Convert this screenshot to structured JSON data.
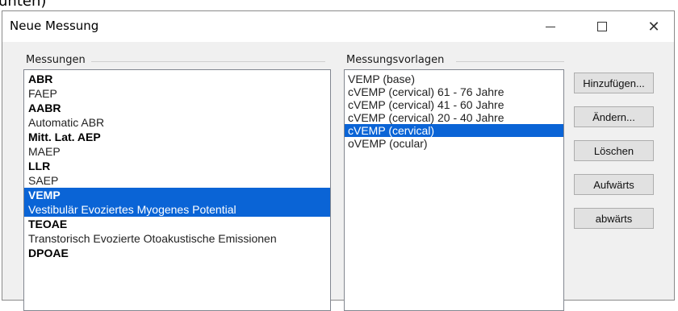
{
  "window": {
    "title": "Neue Messung",
    "top_fragment": "unten)"
  },
  "measurements": {
    "label": "Messungen",
    "items": [
      {
        "text": "ABR",
        "bold": true,
        "selected": false
      },
      {
        "text": "FAEP",
        "bold": false,
        "selected": false
      },
      {
        "text": "AABR",
        "bold": true,
        "selected": false
      },
      {
        "text": "Automatic ABR",
        "bold": false,
        "selected": false
      },
      {
        "text": "Mitt. Lat. AEP",
        "bold": true,
        "selected": false
      },
      {
        "text": "MAEP",
        "bold": false,
        "selected": false
      },
      {
        "text": "LLR",
        "bold": true,
        "selected": false
      },
      {
        "text": "SAEP",
        "bold": false,
        "selected": false
      },
      {
        "text": "VEMP",
        "bold": true,
        "selected": true
      },
      {
        "text": "Vestibulär Evoziertes Myogenes Potential",
        "bold": false,
        "selected": true
      },
      {
        "text": "TEOAE",
        "bold": true,
        "selected": false
      },
      {
        "text": "Transtorisch Evozierte Otoakustische Emissionen",
        "bold": false,
        "selected": false
      },
      {
        "text": "DPOAE",
        "bold": true,
        "selected": false
      }
    ]
  },
  "templates": {
    "label": "Messungsvorlagen",
    "items": [
      {
        "text": "VEMP (base)",
        "selected": false
      },
      {
        "text": "cVEMP (cervical) 61 - 76 Jahre",
        "selected": false
      },
      {
        "text": "cVEMP (cervical) 41 - 60 Jahre",
        "selected": false
      },
      {
        "text": "cVEMP (cervical) 20 - 40 Jahre",
        "selected": false
      },
      {
        "text": "cVEMP (cervical)",
        "selected": true
      },
      {
        "text": "oVEMP (ocular)",
        "selected": false
      }
    ]
  },
  "buttons": {
    "add": "Hinzufügen...",
    "edit": "Ändern...",
    "delete": "Löschen",
    "up": "Aufwärts",
    "down": "abwärts"
  },
  "titlebar_buttons": {
    "close_glyph": "✕"
  },
  "colors": {
    "selection": "#0a64d6",
    "dialog_background": "#f0f0f0"
  }
}
